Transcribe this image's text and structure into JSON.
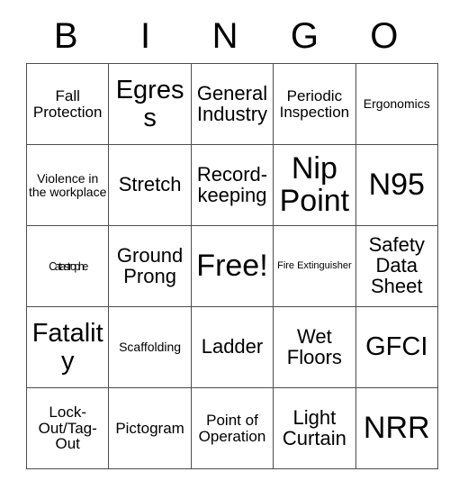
{
  "card": {
    "header_letters": [
      "B",
      "I",
      "N",
      "G",
      "O"
    ],
    "columns": 5,
    "rows": 5,
    "border_color": "#4d4d4d",
    "text_color": "#000000",
    "background_color": "#ffffff",
    "free_space_label": "Free!",
    "free_space_position": "row3-col3",
    "cells": [
      [
        {
          "label": "Fall Protection",
          "size": "sm"
        },
        {
          "label": "Egress",
          "size": "lg"
        },
        {
          "label": "General Industry",
          "size": "md"
        },
        {
          "label": "Periodic Inspection",
          "size": "sm"
        },
        {
          "label": "Ergonomics",
          "size": "xs"
        }
      ],
      [
        {
          "label": "Violence in the workplace",
          "size": "xs"
        },
        {
          "label": "Stretch",
          "size": "md"
        },
        {
          "label": "Record-keeping",
          "size": "md"
        },
        {
          "label": "Nip Point",
          "size": "xl"
        },
        {
          "label": "N95",
          "size": "xl"
        }
      ],
      [
        {
          "label": "Catastrophe",
          "size": "condensed"
        },
        {
          "label": "Ground Prong",
          "size": "md"
        },
        {
          "label": "Free!",
          "size": "xl"
        },
        {
          "label": "Fire Extinguisher",
          "size": "xxs"
        },
        {
          "label": "Safety Data Sheet",
          "size": "md"
        }
      ],
      [
        {
          "label": "Fatality",
          "size": "lg"
        },
        {
          "label": "Scaffolding",
          "size": "xs"
        },
        {
          "label": "Ladder",
          "size": "md"
        },
        {
          "label": "Wet Floors",
          "size": "md"
        },
        {
          "label": "GFCI",
          "size": "lg"
        }
      ],
      [
        {
          "label": "Lock-Out/Tag-Out",
          "size": "sm"
        },
        {
          "label": "Pictogram",
          "size": "sm"
        },
        {
          "label": "Point of Operation",
          "size": "sm"
        },
        {
          "label": "Light Curtain",
          "size": "md"
        },
        {
          "label": "NRR",
          "size": "xl"
        }
      ]
    ]
  }
}
